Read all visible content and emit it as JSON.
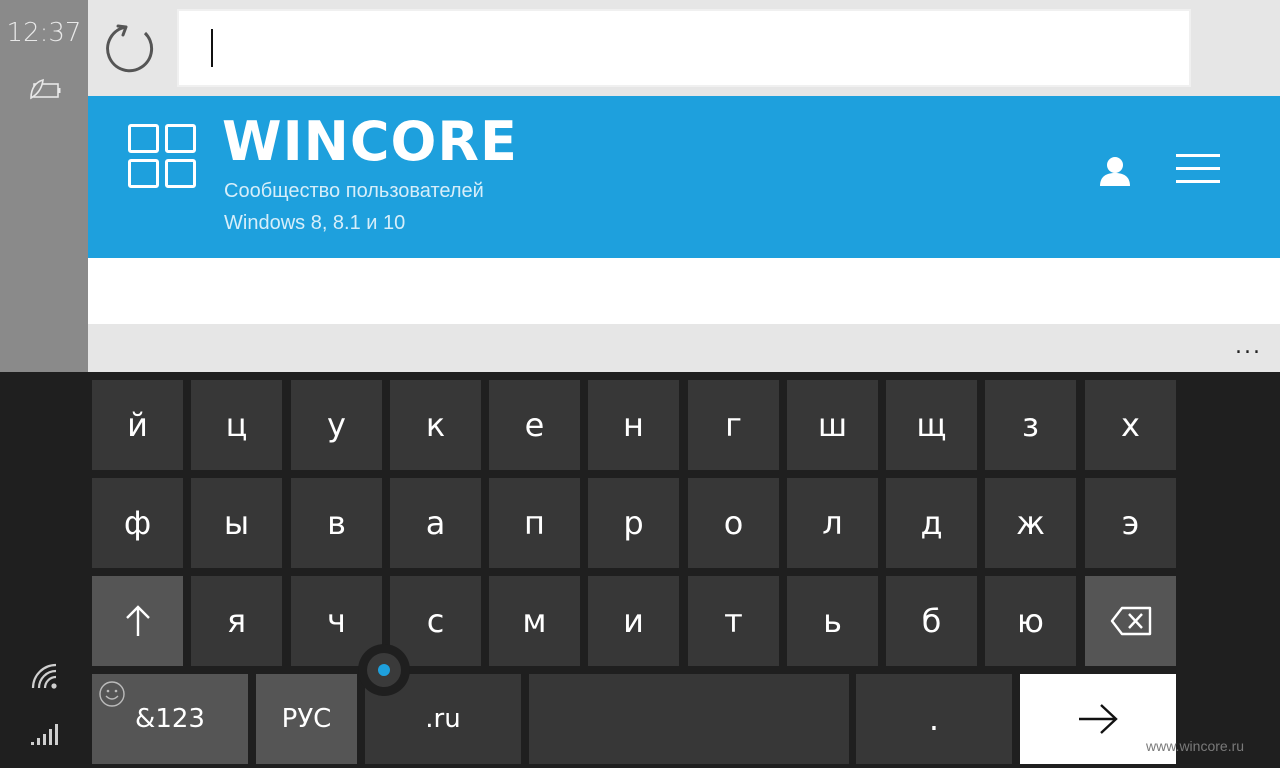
{
  "status": {
    "time": "12:37",
    "icons": [
      "battery-saver-icon",
      "wifi-icon",
      "signal-icon"
    ]
  },
  "browser": {
    "refresh_icon": "refresh-icon",
    "address_value": "",
    "more_label": "..."
  },
  "site": {
    "title": "WINCORE",
    "subtitle_line1": "Сообщество пользователей",
    "subtitle_line2": "Windows 8, 8.1 и 10",
    "accent_color": "#1ea0dd",
    "icons": [
      "logo-grid-icon",
      "user-icon",
      "hamburger-menu-icon"
    ]
  },
  "keyboard": {
    "row1": [
      "й",
      "ц",
      "у",
      "к",
      "е",
      "н",
      "г",
      "ш",
      "щ",
      "з",
      "х"
    ],
    "row2": [
      "ф",
      "ы",
      "в",
      "а",
      "п",
      "р",
      "о",
      "л",
      "д",
      "ж",
      "э"
    ],
    "row3": [
      "я",
      "ч",
      "с",
      "м",
      "и",
      "т",
      "ь",
      "б",
      "ю"
    ],
    "shift_icon": "shift-arrow-icon",
    "backspace_icon": "backspace-icon",
    "symbols_label": "&123",
    "language_label": "РУС",
    "domain_label": ".ru",
    "space_label": "",
    "period_label": ".",
    "enter_icon": "arrow-right-icon",
    "emoji_icon": "emoji-icon"
  },
  "watermark": "www.wincore.ru"
}
